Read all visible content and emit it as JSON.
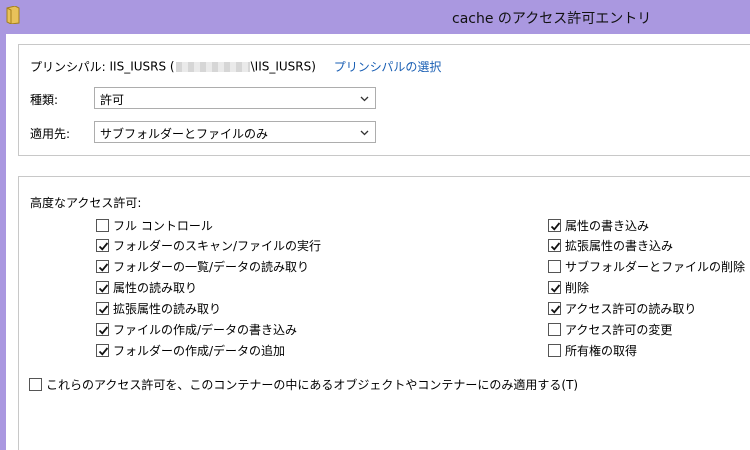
{
  "window": {
    "title": "cache のアクセス許可エントリ"
  },
  "principal": {
    "label": "プリンシパル:",
    "value_prefix": "IIS_IUSRS (",
    "value_suffix": "\\IIS_IUSRS)",
    "select_link": "プリンシパルの選択"
  },
  "type": {
    "label": "種類:",
    "value": "許可"
  },
  "applies_to": {
    "label": "適用先:",
    "value": "サブフォルダーとファイルのみ"
  },
  "advanced": {
    "label": "高度なアクセス許可:",
    "left": [
      {
        "label": "フル コントロール",
        "checked": false
      },
      {
        "label": "フォルダーのスキャン/ファイルの実行",
        "checked": true
      },
      {
        "label": "フォルダーの一覧/データの読み取り",
        "checked": true
      },
      {
        "label": "属性の読み取り",
        "checked": true
      },
      {
        "label": "拡張属性の読み取り",
        "checked": true
      },
      {
        "label": "ファイルの作成/データの書き込み",
        "checked": true
      },
      {
        "label": "フォルダーの作成/データの追加",
        "checked": true
      }
    ],
    "right": [
      {
        "label": "属性の書き込み",
        "checked": true
      },
      {
        "label": "拡張属性の書き込み",
        "checked": true
      },
      {
        "label": "サブフォルダーとファイルの削除",
        "checked": false
      },
      {
        "label": "削除",
        "checked": true
      },
      {
        "label": "アクセス許可の読み取り",
        "checked": true
      },
      {
        "label": "アクセス許可の変更",
        "checked": false
      },
      {
        "label": "所有権の取得",
        "checked": false
      }
    ]
  },
  "apply_only": {
    "label": "これらのアクセス許可を、このコンテナーの中にあるオブジェクトやコンテナーにのみ適用する(T)",
    "checked": false
  },
  "colors": {
    "titlebar": "#aa98e0",
    "link": "#1a5fb4"
  }
}
